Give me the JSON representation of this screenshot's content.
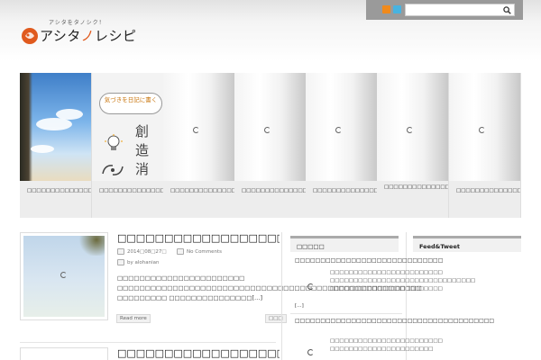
{
  "site": {
    "tagline": "アシタをタノシク！",
    "name_pre": "アシタ",
    "name_post": "レシピ",
    "name_accent": "ノ"
  },
  "search": {
    "placeholder": "",
    "value": ""
  },
  "icons": {
    "rss": "rss-icon",
    "twitter": "twitter-icon",
    "search": "search-icon"
  },
  "colors": {
    "accent": "#e05a1e",
    "rss": "#f08a1c",
    "twitter": "#48b3e0",
    "util_bar": "#9a9a9a"
  },
  "slider": {
    "slides": [
      {
        "caption": "□□□□□□□□□□□□□□□□□□□□□□□□□□□□□□□□"
      },
      {
        "caption": "□□□□□□□□□□□□□□□□□□□□□□□□□□□□□□□□□□□□",
        "bubble": "気づきを日記に書く",
        "kanji": [
          "創",
          "造",
          "消"
        ]
      },
      {
        "caption": "□□□□□□□□□□□□□□□□□□□□□□□□□□□□"
      },
      {
        "caption": "□□□□□□□□□□□□□□□□□□□□□□□□□□□□□□"
      },
      {
        "caption": "□□□□□□□□□□□□□□□□□□□□□□□PC□□□□□□"
      },
      {
        "caption": "□□□□□□□□□□□□□□□□□□□□□□□□□□□□□□□□□□□□□□□□□□7□□□"
      },
      {
        "caption": "□□□□□□□□□□□□□□□□□□□□□□"
      }
    ]
  },
  "posts": [
    {
      "title": "□□□□□□□□□□□□□□□□□□□□□□□□□□□",
      "date": "2014□08□27□",
      "comments": "No Comments",
      "author": "by alohanian",
      "excerpt": "□□□□□□□□□□□□□□□□□□□□□□□ □□□□□□□□□□□□□□□□□□□□□□□□□□□□□□□□□□□□□□□□□□□□□□□□□□□□□□□ □□□□□□□□□ □□□□□□□□□□□□□□□[…]",
      "read_more": "Read more",
      "aux": "□□□"
    },
    {
      "title": "□□□□□□□□□□□□□□□□□□□□□□□□□□□□□□□□□□□"
    }
  ],
  "widgets": {
    "popular": {
      "title": "□□□□□",
      "items": [
        {
          "title": "□□□□□□□□□□□□□□□□□□□□□□□□□□□□□",
          "excerpt": "□□□□□□□□□□□□□□□□□□□□□□□□ □□□□□□□□□□□□□□□□□□□□□□□□□□□□□□□ □□□□□□□□□□□□□□□□□□□□□□□□",
          "more": "[…]"
        },
        {
          "title": "□□□□□□□□□□□□□□□□□□□□□□□□□□□□□□□□□□□□□□□",
          "excerpt": "□□□□□□□□□□□□□□□□□□□□□□□□ □□□□□□□□□□□□□□□□□□□□□□"
        }
      ]
    },
    "feed": {
      "title": "Feed&Tweet"
    }
  }
}
